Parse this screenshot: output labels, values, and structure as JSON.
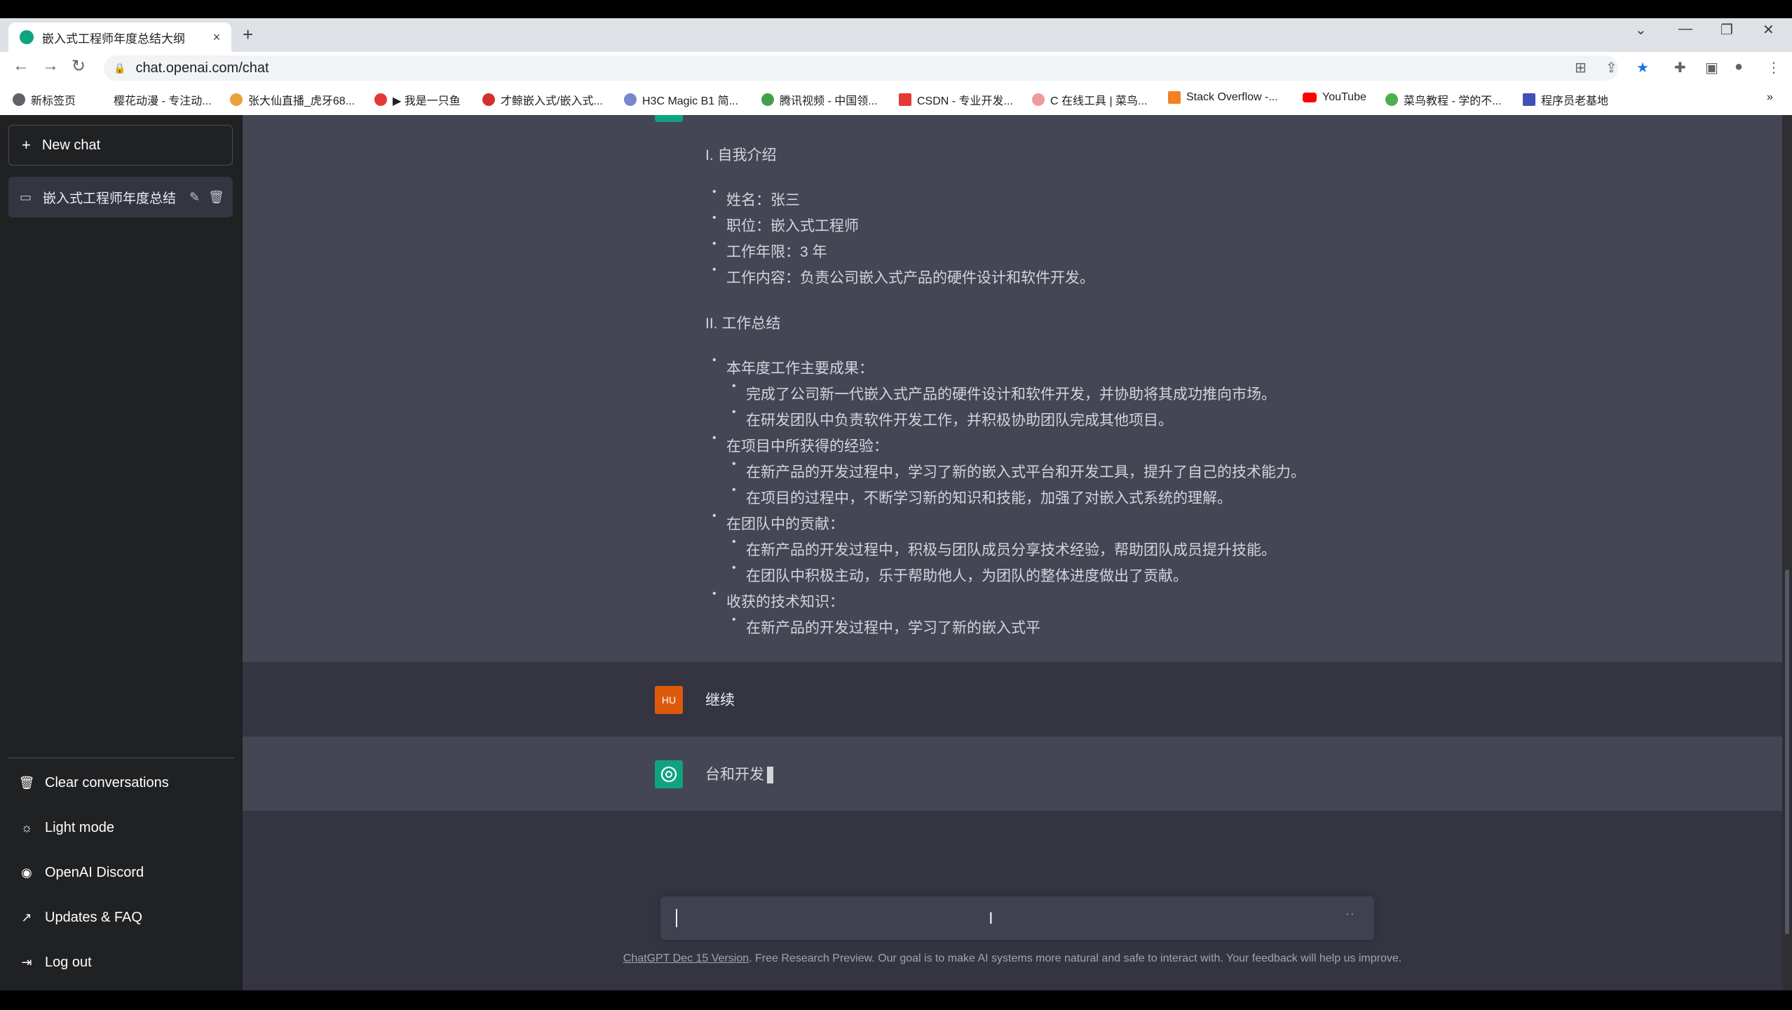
{
  "browser": {
    "tab_title": "嵌入式工程师年度总结大纲",
    "tab_close": "×",
    "new_tab": "+",
    "url": "chat.openai.com/chat",
    "bookmarks": [
      "新标签页",
      "樱花动漫 - 专注动...",
      "张大仙直播_虎牙68...",
      "▶ 我是一只鱼",
      "才鲸嵌入式/嵌入式...",
      "H3C Magic B1 简...",
      "腾讯视频 - 中国领...",
      "CSDN - 专业开发...",
      "C 在线工具 | 菜鸟...",
      "Stack Overflow -...",
      "YouTube",
      "菜鸟教程 - 学的不...",
      "程序员老基地"
    ],
    "bookmark_overflow": "»"
  },
  "sidebar": {
    "new_chat": "New chat",
    "conversation": "嵌入式工程师年度总结",
    "bottom": {
      "clear": "Clear conversations",
      "light": "Light mode",
      "discord": "OpenAI Discord",
      "faq": "Updates & FAQ",
      "logout": "Log out"
    }
  },
  "chat": {
    "assistant_message": {
      "h1": "I. 自我介绍",
      "intro": [
        "姓名：张三",
        "职位：嵌入式工程师",
        "工作年限：3 年",
        "工作内容：负责公司嵌入式产品的硬件设计和软件开发。"
      ],
      "h2": "II. 工作总结",
      "sections": [
        {
          "title": "本年度工作主要成果：",
          "items": [
            "完成了公司新一代嵌入式产品的硬件设计和软件开发，并协助将其成功推向市场。",
            "在研发团队中负责软件开发工作，并积极协助团队完成其他项目。"
          ]
        },
        {
          "title": "在项目中所获得的经验：",
          "items": [
            "在新产品的开发过程中，学习了新的嵌入式平台和开发工具，提升了自己的技术能力。",
            "在项目的过程中，不断学习新的知识和技能，加强了对嵌入式系统的理解。"
          ]
        },
        {
          "title": "在团队中的贡献：",
          "items": [
            "在新产品的开发过程中，积极与团队成员分享技术经验，帮助团队成员提升技能。",
            "在团队中积极主动，乐于帮助他人，为团队的整体进度做出了贡献。"
          ]
        },
        {
          "title": "收获的技术知识：",
          "items": [
            "在新产品的开发过程中，学习了新的嵌入式平"
          ]
        }
      ]
    },
    "user_avatar": "HU",
    "user_message": "继续",
    "assistant_reply": "台和开发",
    "input_dots": "··",
    "footer_link": "ChatGPT Dec 15 Version",
    "footer_text": ". Free Research Preview. Our goal is to make AI systems more natural and safe to interact with. Your feedback will help us improve."
  },
  "colors": {
    "sidebar_bg": "#202123",
    "main_bg": "#343541",
    "assistant_bg": "#444654",
    "openai_green": "#10a37f",
    "user_avatar": "#dd5a0c"
  }
}
